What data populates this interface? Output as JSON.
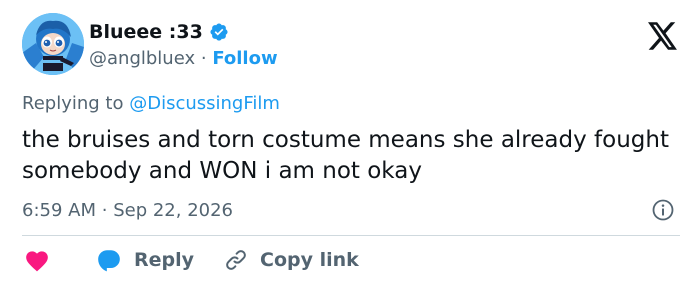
{
  "author": {
    "display_name": "Blueee :33",
    "handle": "@anglbluex",
    "separator": "·",
    "follow_label": "Follow",
    "verified": true
  },
  "reply_context": {
    "prefix": "Replying to",
    "mention": "@DiscussingFilm"
  },
  "tweet": {
    "text": "the bruises and torn costume means she already fought somebody and WON i am not okay",
    "time": "6:59 AM",
    "separator": "·",
    "date": "Sep 22, 2026"
  },
  "actions": {
    "reply_label": "Reply",
    "copy_link_label": "Copy link"
  },
  "icons": {
    "verified": "verified-badge-icon",
    "logo": "x-logo-icon",
    "info": "info-icon",
    "like": "heart-icon",
    "reply": "reply-bubble-icon",
    "copy_link": "link-icon"
  },
  "colors": {
    "accent": "#1d9bf0",
    "like": "#f91880",
    "text_primary": "#0f1419",
    "text_secondary": "#536471",
    "divider": "#cfd9de"
  }
}
